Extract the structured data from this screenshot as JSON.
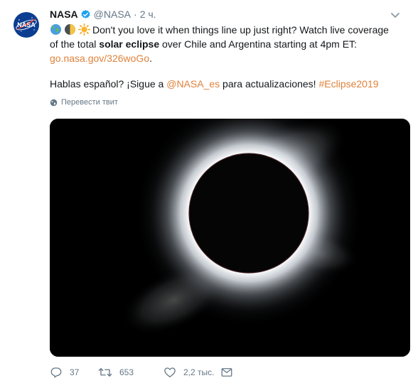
{
  "tweet": {
    "author_name": "NASA",
    "handle": "@NASA",
    "separator": "·",
    "time": "2 ч.",
    "text": {
      "line1_rest": "Don't you love it when things line up just right? Watch live coverage of the total ",
      "bold": "solar eclipse",
      "after_bold": " over Chile and Argentina starting at 4pm ET: ",
      "link": "go.nasa.gov/326woGo",
      "link_end": ".",
      "p2_start": "Hablas español? ¡Sigue a ",
      "mention": "@NASA_es",
      "p2_middle": " para actualizaciones! ",
      "hashtag": "#Eclipse2019"
    },
    "emojis": [
      "globe-icon",
      "first-quarter-moon-icon",
      "sun-icon"
    ],
    "translate_label": "Перевести твит",
    "actions": {
      "replies": "37",
      "retweets": "653",
      "likes": "2,2 тыс."
    }
  },
  "colors": {
    "link": "#e0823a",
    "text": "#14171a",
    "muted": "#657786",
    "verified": "#1da1f2",
    "nasa_blue": "#0b3d91",
    "nasa_red": "#fc3d21"
  }
}
